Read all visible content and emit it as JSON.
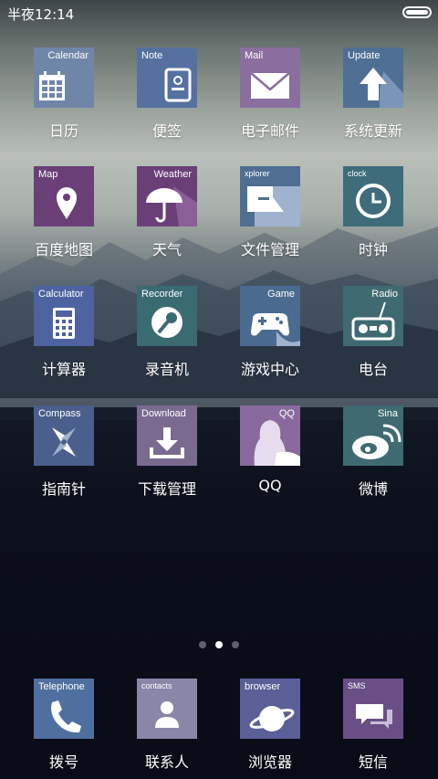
{
  "status_bar": {
    "time": "半夜12:14"
  },
  "apps": [
    {
      "en": "Calendar",
      "name": "日历",
      "color": "#6f86a8",
      "icon": "calendar-icon"
    },
    {
      "en": "Note",
      "name": "便签",
      "color": "#5671a0",
      "icon": "note-icon"
    },
    {
      "en": "Mail",
      "name": "电子邮件",
      "color": "#8a6e9e",
      "icon": "mail-icon"
    },
    {
      "en": "Update",
      "name": "系统更新",
      "color": "#4e6e94",
      "icon": "update-arrow-icon"
    },
    {
      "en": "Map",
      "name": "百度地图",
      "color": "#6a3f78",
      "icon": "map-pin-icon"
    },
    {
      "en": "Weather",
      "name": "天气",
      "color": "#6a3f78",
      "icon": "umbrella-icon"
    },
    {
      "en": "xplorer",
      "name": "文件管理",
      "color": "#4f6e92",
      "icon": "folder-icon"
    },
    {
      "en": "clock",
      "name": "时钟",
      "color": "#3f6c7a",
      "icon": "clock-icon"
    },
    {
      "en": "Calculator",
      "name": "计算器",
      "color": "#4e62a0",
      "icon": "calculator-icon"
    },
    {
      "en": "Recorder",
      "name": "录音机",
      "color": "#3a6a72",
      "icon": "microphone-icon"
    },
    {
      "en": "Game",
      "name": "游戏中心",
      "color": "#4b6a90",
      "icon": "gamepad-icon"
    },
    {
      "en": "Radio",
      "name": "电台",
      "color": "#3f6a72",
      "icon": "radio-icon"
    },
    {
      "en": "Compass",
      "name": "指南针",
      "color": "#4a5f8c",
      "icon": "compass-icon"
    },
    {
      "en": "Download",
      "name": "下载管理",
      "color": "#7a6a90",
      "icon": "download-icon"
    },
    {
      "en": "QQ",
      "name": "QQ",
      "color": "#8a6a9e",
      "icon": "qq-penguin-icon"
    },
    {
      "en": "Sina",
      "name": "微博",
      "color": "#3f6a72",
      "icon": "weibo-icon"
    }
  ],
  "dock": [
    {
      "en": "Telephone",
      "name": "拨号",
      "color": "#4f6fa0",
      "icon": "phone-icon"
    },
    {
      "en": "contacts",
      "name": "联系人",
      "color": "#8a86a8",
      "icon": "contact-person-icon"
    },
    {
      "en": "browser",
      "name": "浏览器",
      "color": "#5a5f98",
      "icon": "planet-icon"
    },
    {
      "en": "SMS",
      "name": "短信",
      "color": "#6a4f86",
      "icon": "sms-bubble-icon"
    }
  ],
  "pager": {
    "pages": 3,
    "current": 2
  }
}
